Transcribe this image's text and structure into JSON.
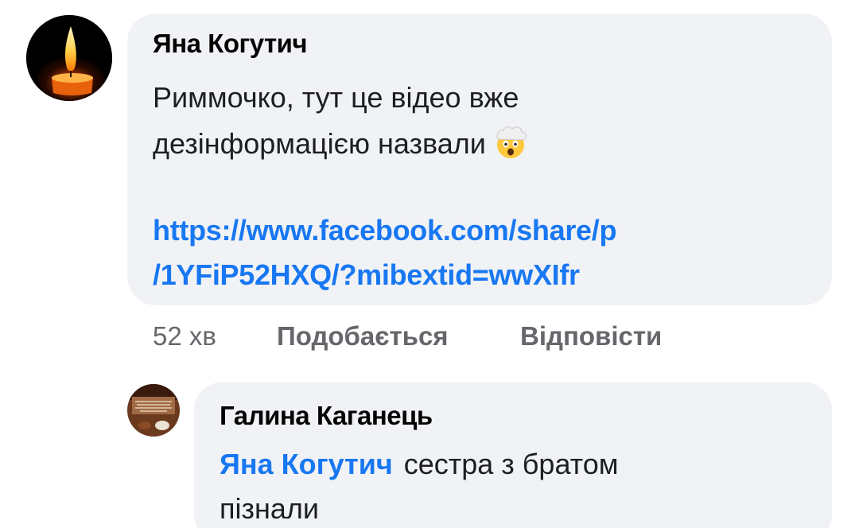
{
  "comment": {
    "author": "Яна Когутич",
    "text_line1": "Риммочко, тут це відео вже",
    "text_line2": "дезінформацією назвали",
    "emoji": "shocked-face-with-exploding-head",
    "link_line1": "https://www.facebook.com/share/p",
    "link_line2": "/1YFiP52HXQ/?mibextid=wwXIfr",
    "avatar": "candle-flame-icon",
    "actions": {
      "time": "52 хв",
      "like": "Подобається",
      "reply": "Відповісти"
    }
  },
  "reply": {
    "author": "Галина Каганець",
    "mention": "Яна Когутич",
    "text_line1": "сестра з братом",
    "text_line2": "пізнали",
    "avatar": "profile-photo"
  },
  "colors": {
    "bubble": "#f0f2f5",
    "link": "#1877f2",
    "meta": "#65676b",
    "text": "#050505"
  }
}
